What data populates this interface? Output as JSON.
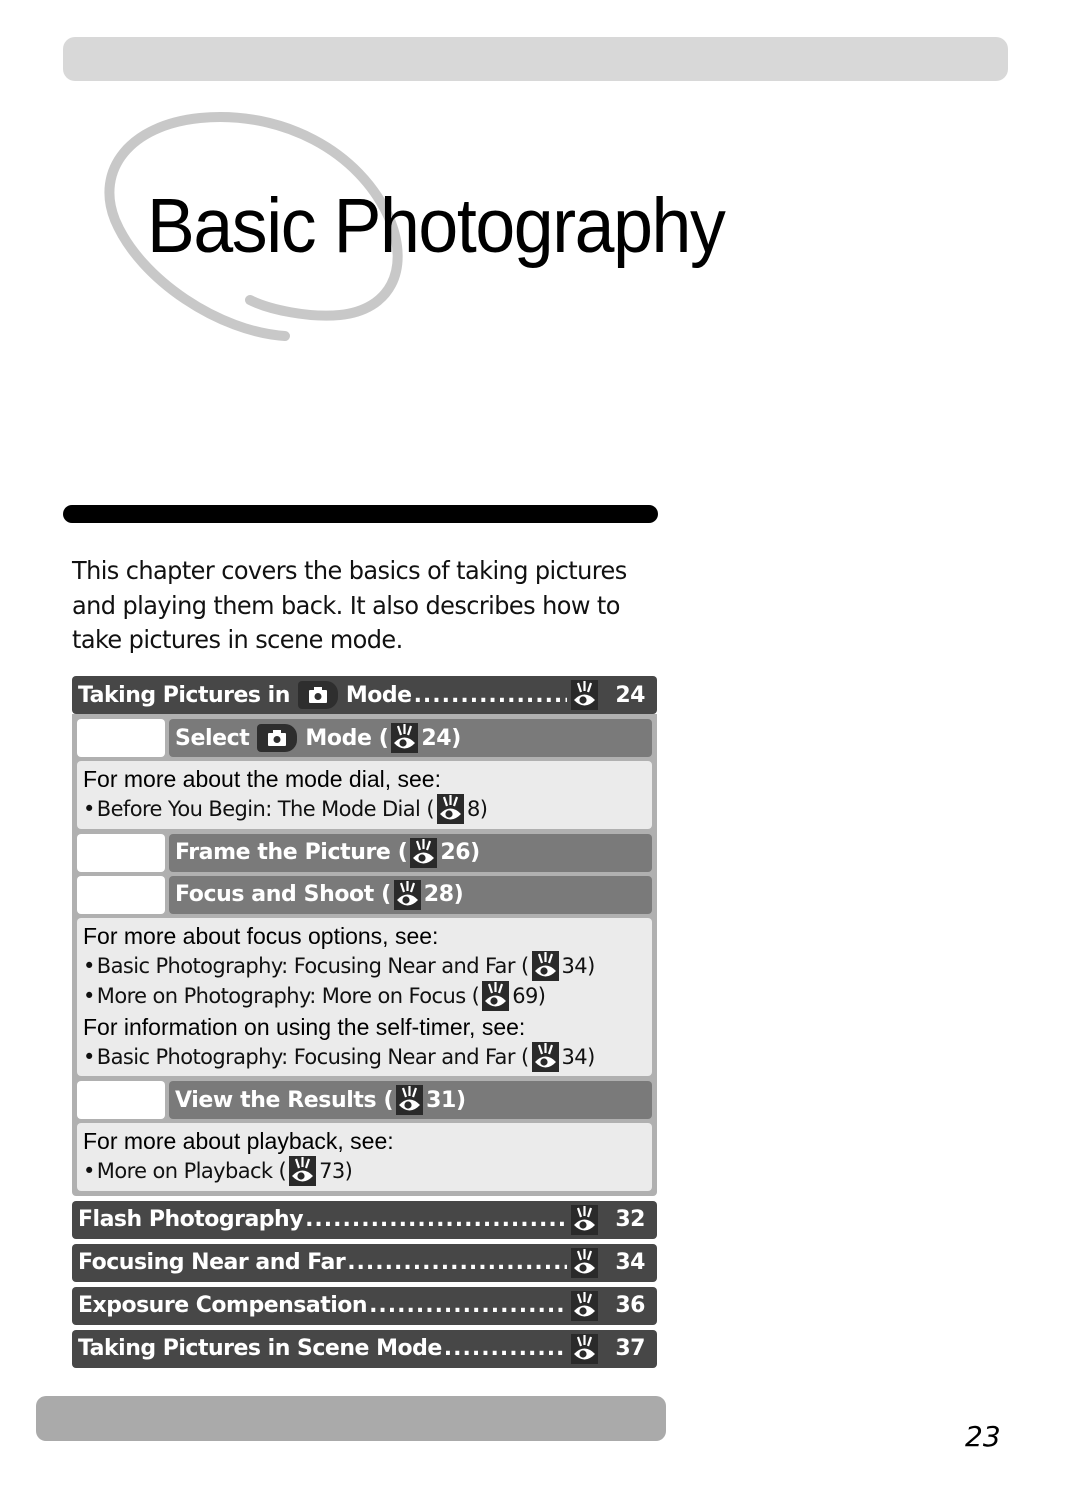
{
  "chapter": {
    "title": "Basic Photography",
    "intro": "This chapter covers the basics of taking pictures and playing them back.  It also describes how to take pictures in scene mode."
  },
  "toc": {
    "section_main": {
      "label_pre": "Taking Pictures in",
      "label_post": "Mode",
      "dots": "....................................",
      "page": "24"
    },
    "steps": [
      {
        "label_pre": "Select",
        "label_post": "Mode (",
        "page_ref": "24)",
        "has_camera_icon": true
      },
      {
        "label_pre": "Frame the Picture (",
        "page_ref": "26)"
      },
      {
        "label_pre": "Focus and Shoot (",
        "page_ref": "28)"
      },
      {
        "label_pre": "View the Results (",
        "page_ref": "31)"
      }
    ],
    "notes": {
      "mode_dial": {
        "head": "For more about the mode dial, see:",
        "items": [
          {
            "text": "Before You Begin: The Mode Dial (",
            "page": "8)"
          }
        ]
      },
      "focus": {
        "head": "For more about focus options, see:",
        "items": [
          {
            "text": "Basic Photography: Focusing Near and Far (",
            "page": "34)"
          },
          {
            "text": "More on Photography: More on Focus (",
            "page": "69)"
          }
        ],
        "head2": "For information on using the self-timer, see:",
        "items2": [
          {
            "text": "Basic Photography: Focusing Near and Far (",
            "page": "34)"
          }
        ]
      },
      "playback": {
        "head": "For more about playback, see:",
        "items": [
          {
            "text": "More on Playback (",
            "page": "73)"
          }
        ]
      }
    },
    "bullet": "•",
    "sections": [
      {
        "label": "Flash Photography",
        "dots": "........................................................",
        "page": "32"
      },
      {
        "label": "Focusing Near and Far",
        "dots": "........................................................",
        "page": "34"
      },
      {
        "label": "Exposure Compensation",
        "dots": "........................................................",
        "page": "36"
      },
      {
        "label": "Taking Pictures in Scene Mode",
        "dots": "........................................................",
        "page": "37"
      }
    ]
  },
  "icons": {
    "page_ref": "eye-icon",
    "auto_mode": "camera-icon"
  },
  "footer": {
    "page_number": "23"
  }
}
